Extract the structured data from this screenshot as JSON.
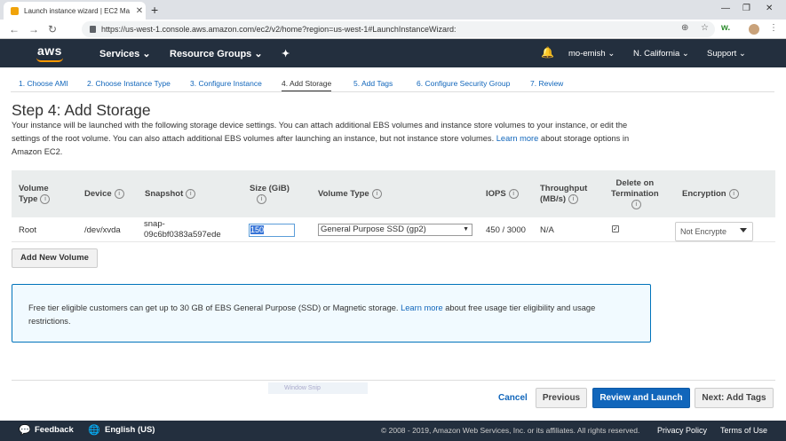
{
  "browser": {
    "tab_title": "Launch instance wizard | EC2 Ma",
    "url": "https://us-west-1.console.aws.amazon.com/ec2/v2/home?region=us-west-1#LaunchInstanceWizard:"
  },
  "aws_nav": {
    "logo": "aws",
    "services": "Services",
    "resource_groups": "Resource Groups",
    "user": "mo-emish",
    "region": "N. California",
    "support": "Support"
  },
  "wizard": {
    "tabs": [
      "1. Choose AMI",
      "2. Choose Instance Type",
      "3. Configure Instance",
      "4. Add Storage",
      "5. Add Tags",
      "6. Configure Security Group",
      "7. Review"
    ],
    "active_index": 3
  },
  "page": {
    "title": "Step 4: Add Storage",
    "desc": "Your instance will be launched with the following storage device settings. You can attach additional EBS volumes and instance store volumes to your instance, or edit the settings of the root volume. You can also attach additional EBS volumes after launching an instance, but not instance store volumes.",
    "desc_link": "Learn more",
    "desc_tail": "about storage options in Amazon EC2."
  },
  "table": {
    "headers": {
      "volume_type_1": "Volume",
      "volume_type_2": "Type",
      "device": "Device",
      "snapshot": "Snapshot",
      "size": "Size (GiB)",
      "volume_type": "Volume Type",
      "iops": "IOPS",
      "throughput_1": "Throughput",
      "throughput_2": "(MB/s)",
      "delete_1": "Delete on",
      "delete_2": "Termination",
      "encryption": "Encryption"
    },
    "row": {
      "volume_type": "Root",
      "device": "/dev/xvda",
      "snapshot_1": "snap-",
      "snapshot_2": "09c6bf0383a597ede",
      "size": "150",
      "volume_type_value": "General Purpose SSD (gp2)",
      "iops": "450 / 3000",
      "throughput": "N/A",
      "delete_on_termination": true,
      "encryption": "Not Encrypte"
    }
  },
  "add_volume": "Add New Volume",
  "info_box": {
    "text": "Free tier eligible customers can get up to 30 GB of EBS General Purpose (SSD) or Magnetic storage.",
    "link": "Learn more",
    "tail": "about free usage tier eligibility and usage restrictions."
  },
  "snip_overlay": "Window Snip",
  "buttons": {
    "cancel": "Cancel",
    "previous": "Previous",
    "review_launch": "Review and Launch",
    "next": "Next: Add Tags"
  },
  "footer": {
    "feedback": "Feedback",
    "language": "English (US)",
    "copyright": "© 2008 - 2019, Amazon Web Services, Inc. or its affiliates. All rights reserved.",
    "privacy": "Privacy Policy",
    "terms": "Terms of Use"
  }
}
